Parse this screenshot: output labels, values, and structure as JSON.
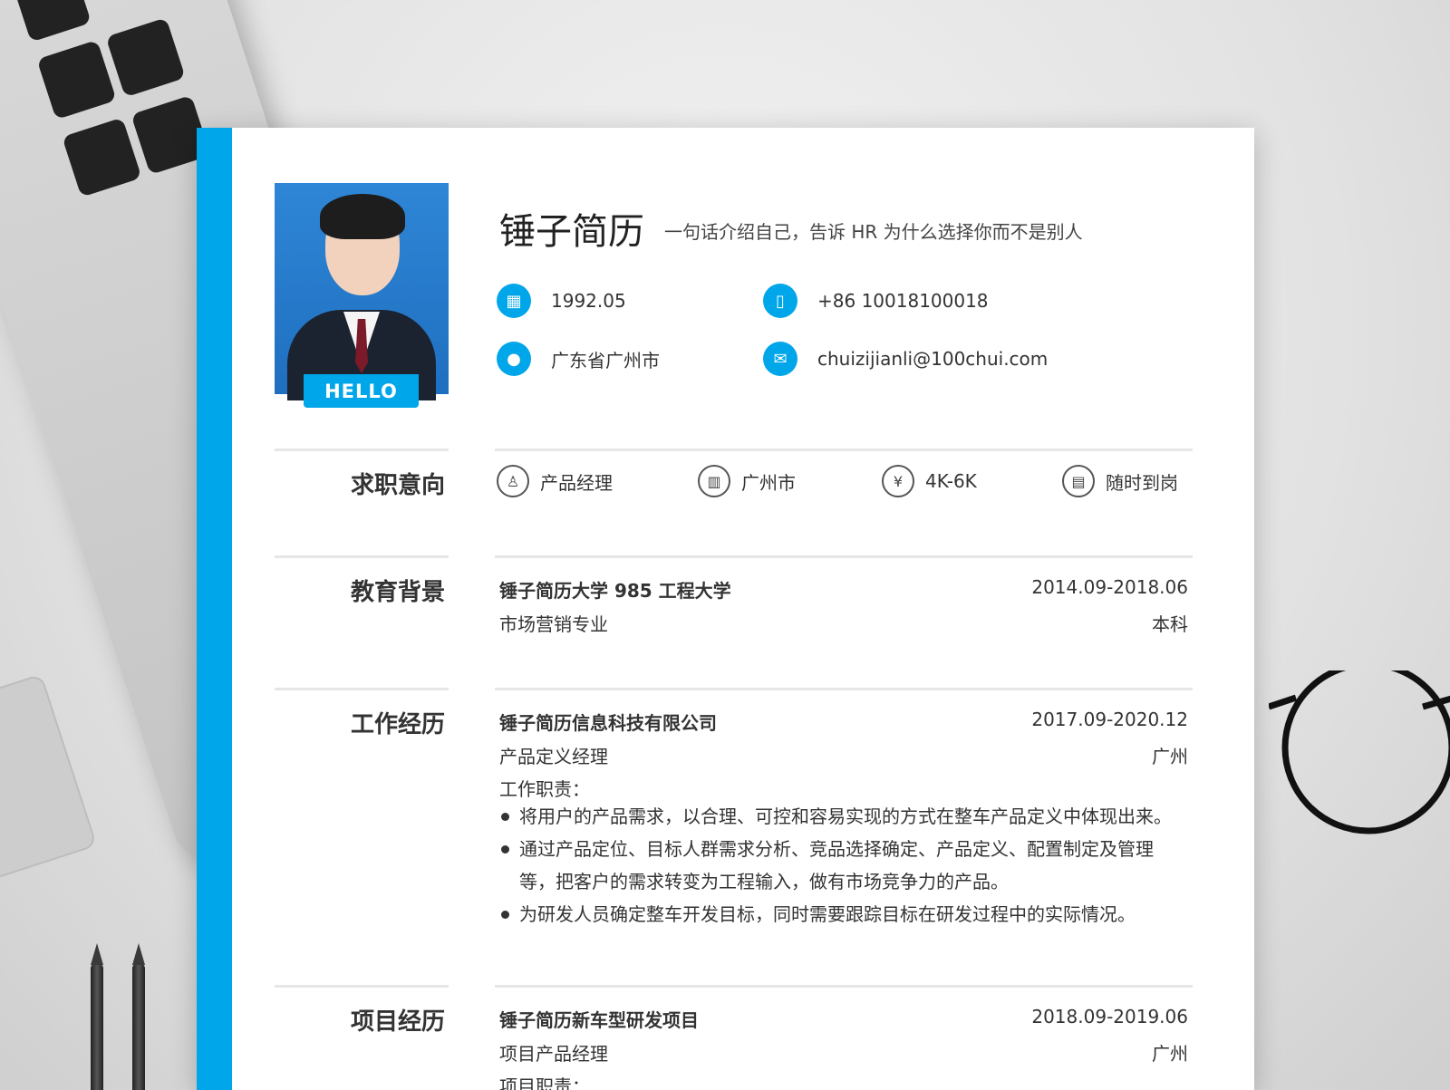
{
  "header": {
    "name": "锤子简历",
    "tagline": "一句话介绍自己，告诉 HR 为什么选择你而不是别人",
    "photo_badge": "HELLO"
  },
  "contact": {
    "birth": "1992.05",
    "phone": "+86 10018100018",
    "location": "广东省广州市",
    "email": "chuizijianli@100chui.com"
  },
  "intent": {
    "title": "求职意向",
    "position": "产品经理",
    "city": "广州市",
    "salary": "4K-6K",
    "availability": "随时到岗"
  },
  "education": {
    "title": "教育背景",
    "school": "锤子简历大学  985 工程大学",
    "period": "2014.09-2018.06",
    "major": "市场营销专业",
    "degree": "本科"
  },
  "work": {
    "title": "工作经历",
    "company": "锤子简历信息科技有限公司",
    "period": "2017.09-2020.12",
    "role": "产品定义经理",
    "city": "广州",
    "duties_label": "工作职责：",
    "duties": [
      "将用户的产品需求，以合理、可控和容易实现的方式在整车产品定义中体现出来。",
      "通过产品定位、目标人群需求分析、竞品选择确定、产品定义、配置制定及管理等，把客户的需求转变为工程输入，做有市场竞争力的产品。",
      "为研发人员确定整车开发目标，同时需要跟踪目标在研发过程中的实际情况。"
    ]
  },
  "project": {
    "title": "项目经历",
    "name": "锤子简历新车型研发项目",
    "period": "2018.09-2019.06",
    "role": "项目产品经理",
    "city": "广州",
    "duties_label": "项目职责："
  },
  "colors": {
    "accent": "#00a6ea"
  }
}
